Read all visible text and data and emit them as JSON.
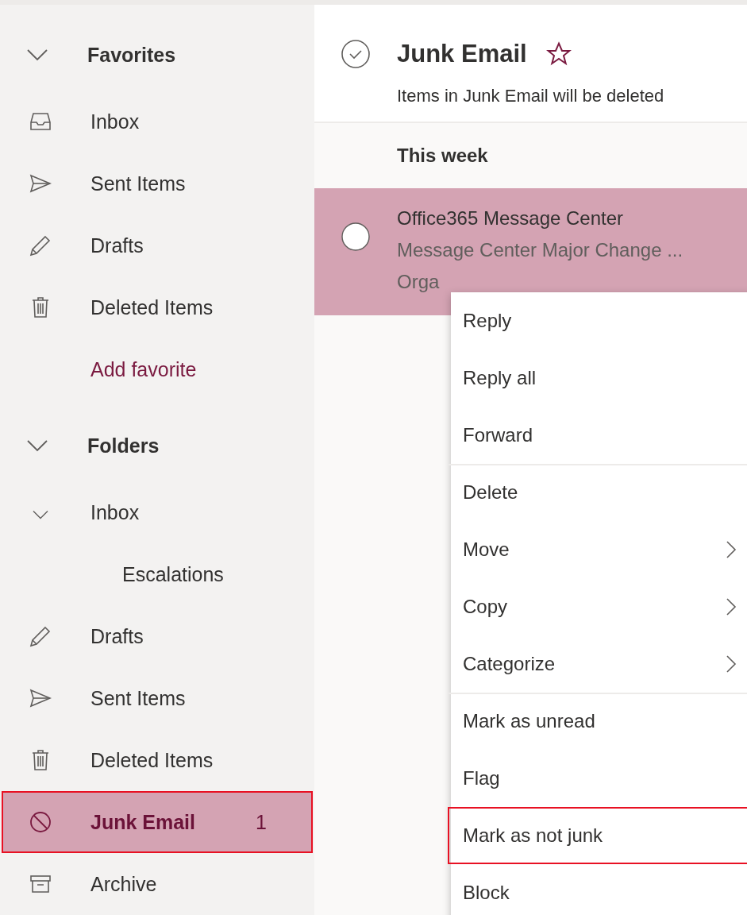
{
  "sidebar": {
    "sections": [
      {
        "title": "Favorites",
        "expanded": true,
        "items": [
          {
            "kind": "inbox",
            "label": "Inbox",
            "selected": false,
            "highlighted": false
          },
          {
            "kind": "sent",
            "label": "Sent Items",
            "selected": false,
            "highlighted": false
          },
          {
            "kind": "drafts",
            "label": "Drafts",
            "selected": false,
            "highlighted": false
          },
          {
            "kind": "deleted",
            "label": "Deleted Items",
            "selected": false,
            "highlighted": false
          },
          {
            "kind": "link",
            "label": "Add favorite"
          }
        ]
      },
      {
        "title": "Folders",
        "expanded": true,
        "items": [
          {
            "kind": "folder",
            "label": "Inbox",
            "selected": false,
            "highlighted": false,
            "expanded": true,
            "children": [
              {
                "kind": "folder",
                "label": "Escalations",
                "selected": false,
                "highlighted": false
              }
            ]
          },
          {
            "kind": "drafts",
            "label": "Drafts",
            "selected": false,
            "highlighted": false
          },
          {
            "kind": "sent",
            "label": "Sent Items",
            "selected": false,
            "highlighted": false
          },
          {
            "kind": "deleted",
            "label": "Deleted Items",
            "selected": false,
            "highlighted": false
          },
          {
            "kind": "junk",
            "label": "Junk Email",
            "count": "1",
            "selected": true,
            "highlighted": true
          },
          {
            "kind": "archive",
            "label": "Archive",
            "selected": false,
            "highlighted": false
          }
        ]
      }
    ]
  },
  "header": {
    "title": "Junk Email",
    "favorite": false,
    "subtitle": "Items in Junk Email will be deleted"
  },
  "message_list": {
    "groups": [
      {
        "label": "This week",
        "messages": [
          {
            "sender": "Office365 Message Center",
            "subject": "Message Center Major Change ...",
            "preview": "Orga",
            "selected": true,
            "checked": false
          }
        ]
      }
    ]
  },
  "context_menu": {
    "items": [
      {
        "label": "Reply",
        "submenu": false,
        "divider_before": false,
        "highlighted": false
      },
      {
        "label": "Reply all",
        "submenu": false,
        "divider_before": false,
        "highlighted": false
      },
      {
        "label": "Forward",
        "submenu": false,
        "divider_before": false,
        "highlighted": false
      },
      {
        "label": "Delete",
        "submenu": false,
        "divider_before": true,
        "highlighted": false
      },
      {
        "label": "Move",
        "submenu": true,
        "divider_before": false,
        "highlighted": false
      },
      {
        "label": "Copy",
        "submenu": true,
        "divider_before": false,
        "highlighted": false
      },
      {
        "label": "Categorize",
        "submenu": true,
        "divider_before": false,
        "highlighted": false
      },
      {
        "label": "Mark as unread",
        "submenu": false,
        "divider_before": true,
        "highlighted": false
      },
      {
        "label": "Flag",
        "submenu": false,
        "divider_before": false,
        "highlighted": false
      },
      {
        "label": "Mark as not junk",
        "submenu": false,
        "divider_before": false,
        "highlighted": true
      },
      {
        "label": "Block",
        "submenu": false,
        "divider_before": false,
        "highlighted": false
      }
    ]
  }
}
